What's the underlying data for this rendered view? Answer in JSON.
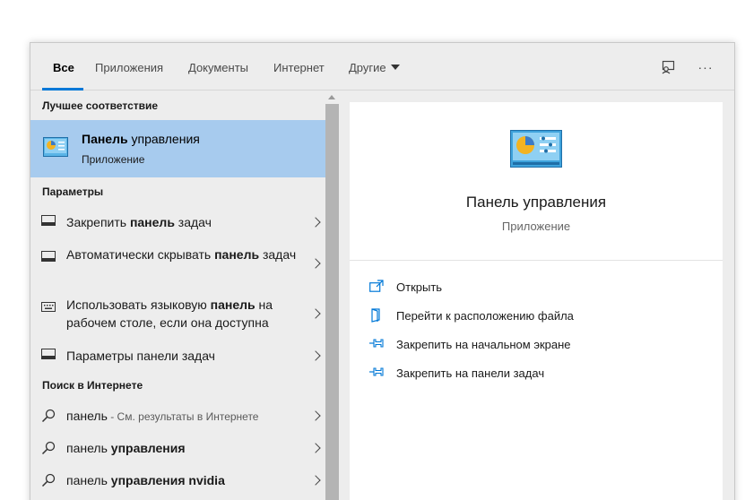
{
  "tabs": [
    {
      "label": "Все"
    },
    {
      "label": "Приложения"
    },
    {
      "label": "Документы"
    },
    {
      "label": "Интернет"
    },
    {
      "label": "Другие"
    }
  ],
  "toolbar": {
    "feedback_icon": "feedback-icon",
    "more_label": "···"
  },
  "best_match": {
    "section": "Лучшее соответствие",
    "title_bold": "Панель",
    "title_rest": " управления",
    "subtitle": "Приложение",
    "icon": "control-panel-icon"
  },
  "settings": {
    "section": "Параметры",
    "items": [
      {
        "pre": "Закрепить ",
        "bold": "панель",
        "post": " задач",
        "icon": "taskbar-icon"
      },
      {
        "pre": "Автоматически скрывать ",
        "bold": "панель",
        "post": " задач",
        "icon": "taskbar-icon"
      },
      {
        "pre": "Использовать языковую ",
        "bold": "панель",
        "post": " на рабочем столе, если она доступна",
        "icon": "keyboard-icon"
      },
      {
        "pre": "Параметры панели задач",
        "bold": "",
        "post": "",
        "icon": "taskbar-icon"
      }
    ]
  },
  "web": {
    "section": "Поиск в Интернете",
    "items": [
      {
        "pre": "панель",
        "bold": "",
        "hint": " - См. результаты в Интернете",
        "icon": "search-icon"
      },
      {
        "pre": "панель ",
        "bold": "управления",
        "hint": "",
        "icon": "search-icon"
      },
      {
        "pre": "панель ",
        "bold": "управления nvidia",
        "hint": "",
        "icon": "search-icon"
      }
    ]
  },
  "preview": {
    "title": "Панель управления",
    "subtitle": "Приложение",
    "actions": [
      {
        "label": "Открыть",
        "icon": "open-icon"
      },
      {
        "label": "Перейти к расположению файла",
        "icon": "file-location-icon"
      },
      {
        "label": "Закрепить на начальном экране",
        "icon": "pin-icon"
      },
      {
        "label": "Закрепить на панели задач",
        "icon": "pin-icon"
      }
    ]
  },
  "colors": {
    "accent": "#0078d7",
    "selected_row": "#a7cbee",
    "panel_bg": "#ededed"
  }
}
